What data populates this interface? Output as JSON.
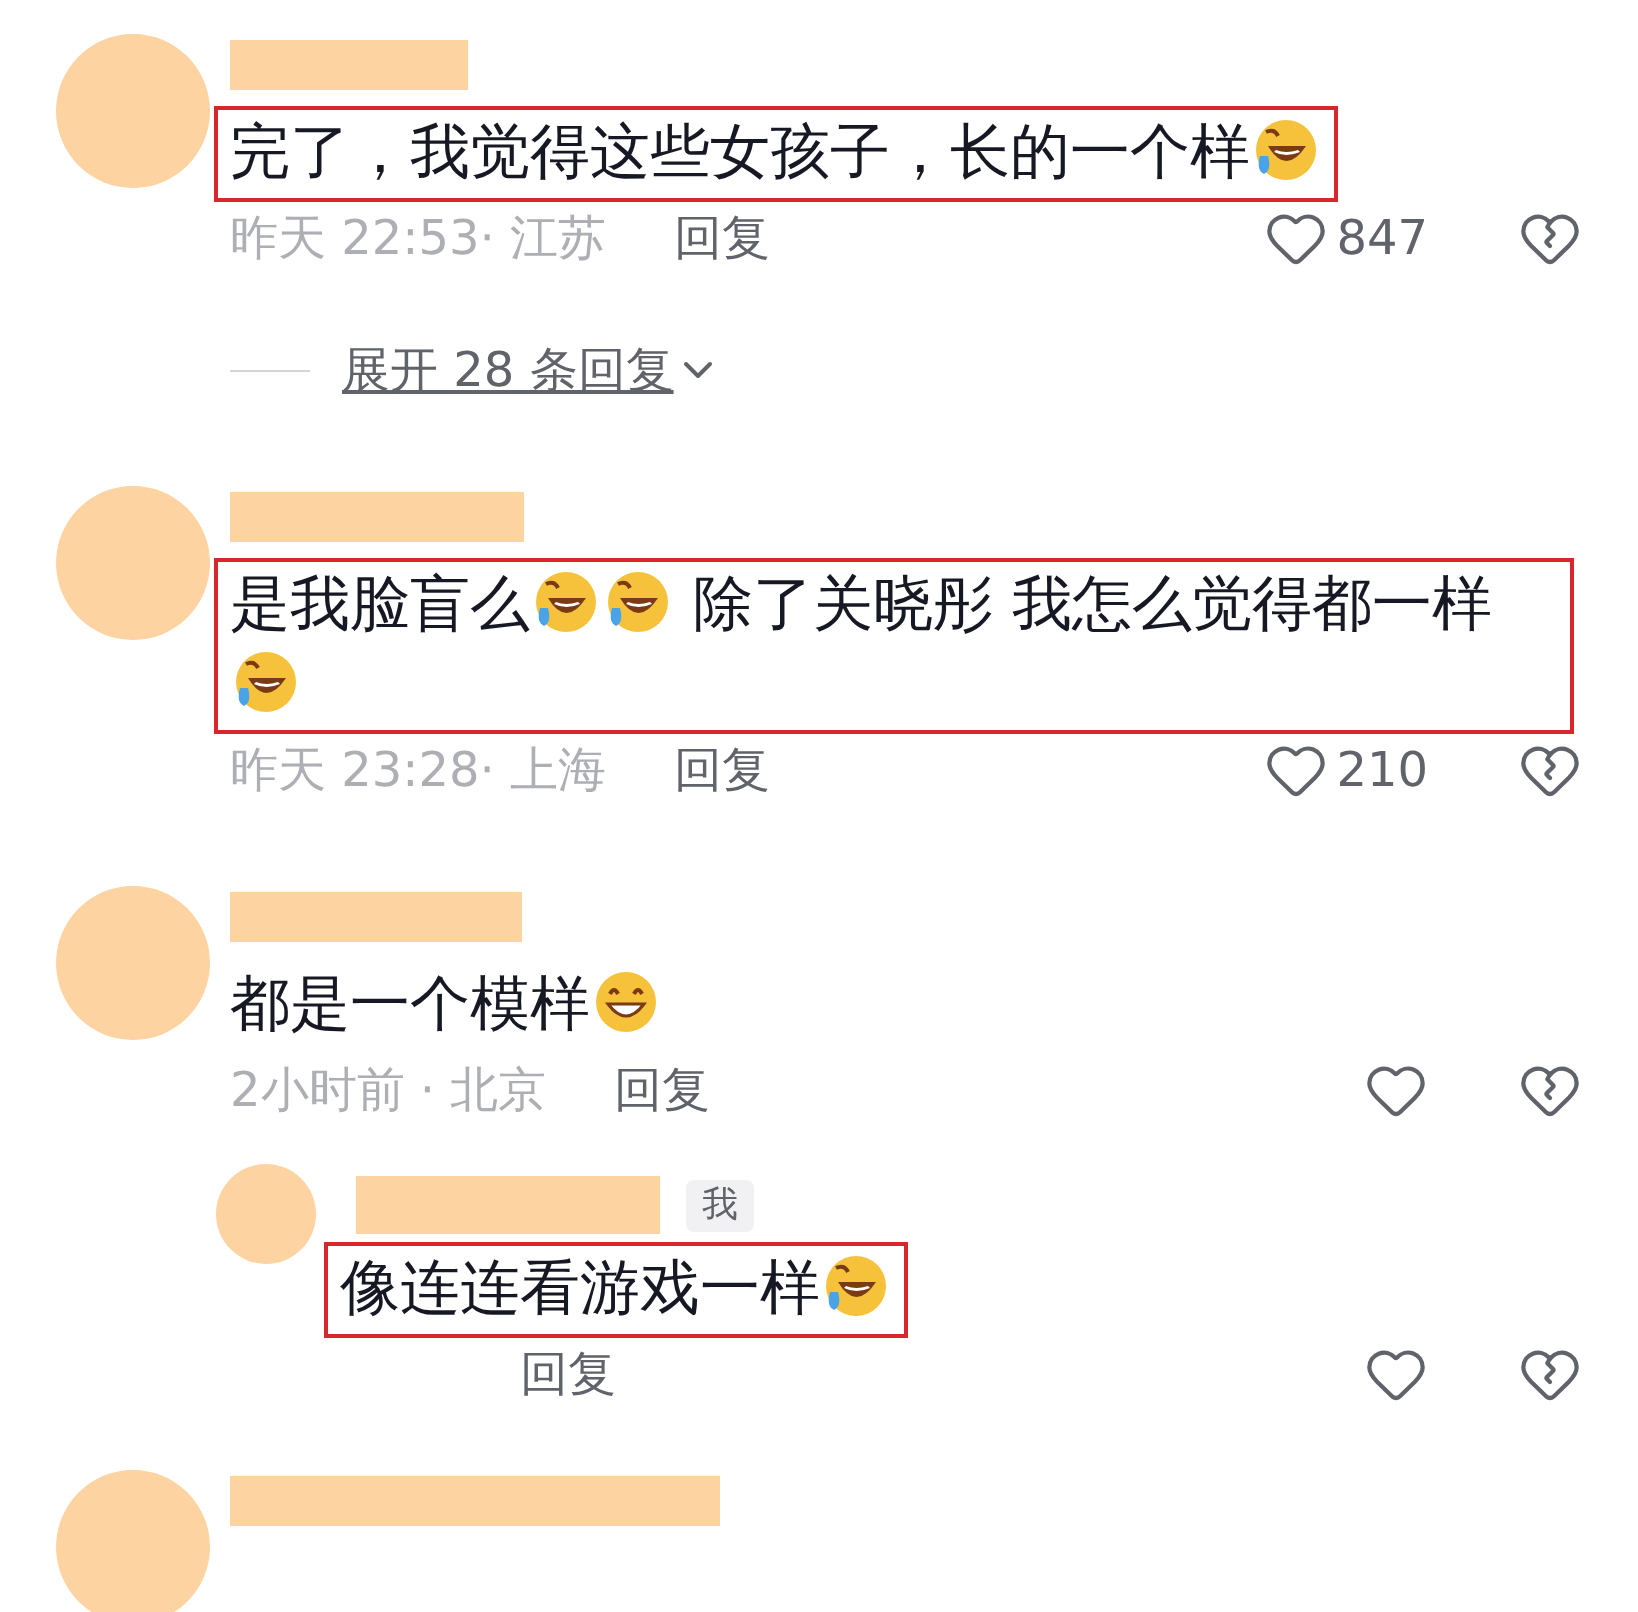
{
  "comments": [
    {
      "highlighted": true,
      "parts": [
        {
          "kind": "text",
          "text": "完了，我觉得这些女孩子，长的一个样"
        },
        {
          "kind": "laughing"
        }
      ],
      "time": "昨天 22:53· 江苏",
      "reply": "回复",
      "likes": "847",
      "expand": "展开 28 条回复"
    },
    {
      "highlighted": true,
      "parts": [
        {
          "kind": "text",
          "text": "是我脸盲么"
        },
        {
          "kind": "laughing"
        },
        {
          "kind": "laughing"
        },
        {
          "kind": "text",
          "text": " 除了关晓彤 我怎么觉得都一样"
        },
        {
          "kind": "laughing"
        }
      ],
      "time": "昨天 23:28· 上海",
      "reply": "回复",
      "likes": "210"
    },
    {
      "highlighted": false,
      "parts": [
        {
          "kind": "text",
          "text": "都是一个模样"
        },
        {
          "kind": "grinning"
        }
      ],
      "time": "2小时前 · 北京",
      "reply": "回复",
      "replies": [
        {
          "tag": "我",
          "highlighted": true,
          "parts": [
            {
              "kind": "text",
              "text": "像连连看游戏一样"
            },
            {
              "kind": "laughing"
            }
          ],
          "reply": "回复"
        }
      ]
    },
    {
      "name_only": true
    }
  ]
}
